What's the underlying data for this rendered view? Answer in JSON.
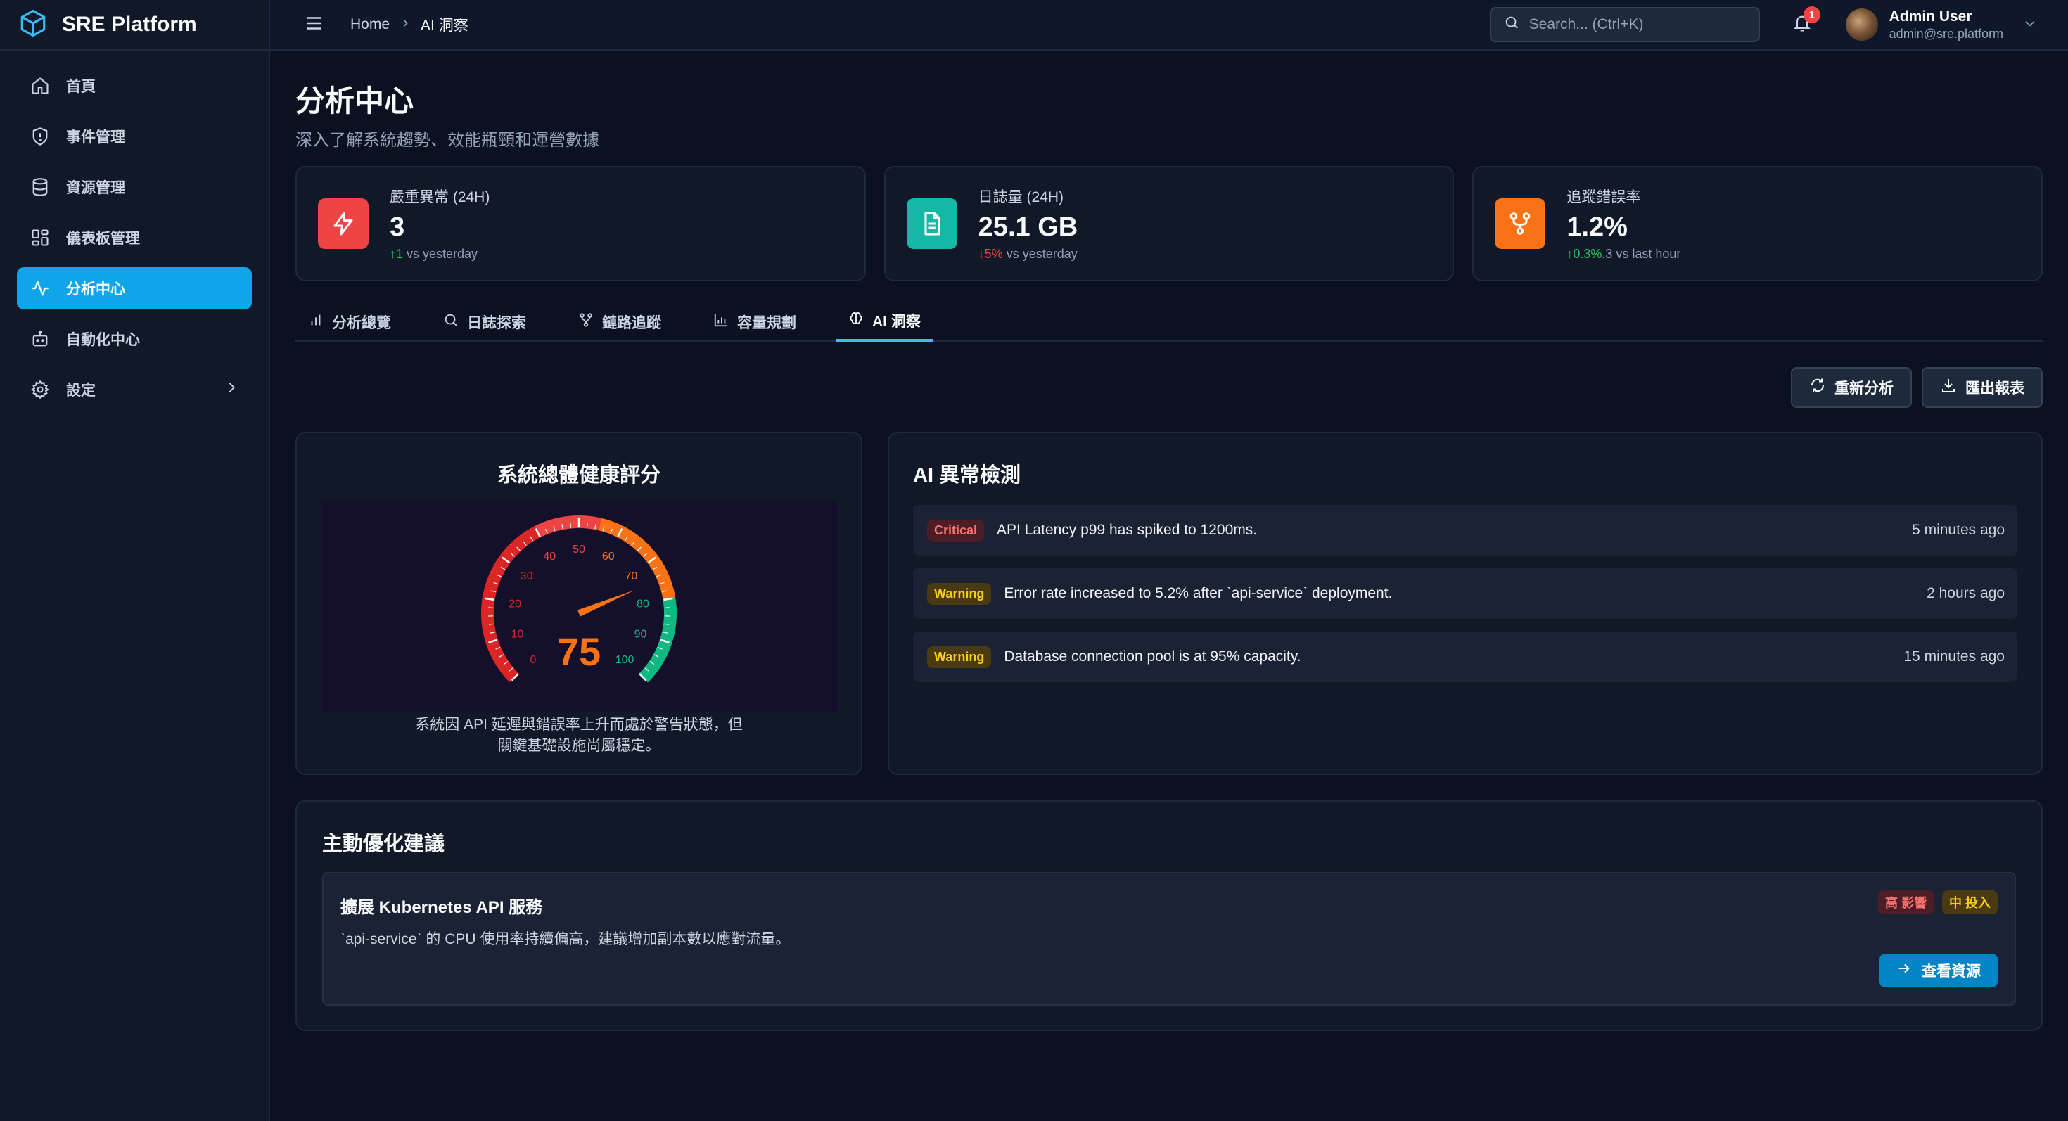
{
  "brand": {
    "name": "SRE Platform"
  },
  "sidebar": {
    "items": [
      {
        "label": "首頁",
        "icon": "home-icon"
      },
      {
        "label": "事件管理",
        "icon": "shield-alert-icon"
      },
      {
        "label": "資源管理",
        "icon": "database-icon"
      },
      {
        "label": "儀表板管理",
        "icon": "dashboard-icon"
      },
      {
        "label": "分析中心",
        "icon": "activity-icon",
        "active": true
      },
      {
        "label": "自動化中心",
        "icon": "bot-icon"
      },
      {
        "label": "設定",
        "icon": "gear-icon"
      }
    ]
  },
  "topbar": {
    "breadcrumb": {
      "home": "Home",
      "current": "AI 洞察"
    },
    "search_placeholder": "Search... (Ctrl+K)",
    "notifications": "1",
    "user": {
      "name": "Admin User",
      "email": "admin@sre.platform"
    }
  },
  "page": {
    "title": "分析中心",
    "subtitle": "深入了解系統趨勢、效能瓶頸和運營數據"
  },
  "stats": [
    {
      "label": "嚴重異常 (24H)",
      "value": "3",
      "delta": "↑1",
      "delta_suffix": " vs yesterday",
      "color": "#ef4444"
    },
    {
      "label": "日誌量 (24H)",
      "value": "25.1 GB",
      "delta": "↓5%",
      "delta_suffix": " vs yesterday",
      "color": "#14b8a6"
    },
    {
      "label": "追蹤錯誤率",
      "value": "1.2%",
      "delta": "↑0.3%",
      "delta_suffix": ".3 vs last hour",
      "color": "#f97316"
    }
  ],
  "tabs": [
    {
      "label": "分析總覽",
      "icon": "bar-chart-icon"
    },
    {
      "label": "日誌探索",
      "icon": "search-icon"
    },
    {
      "label": "鏈路追蹤",
      "icon": "git-fork-icon"
    },
    {
      "label": "容量規劃",
      "icon": "column-chart-icon"
    },
    {
      "label": "AI 洞察",
      "icon": "brain-icon",
      "active": true
    }
  ],
  "actions": {
    "reanalyze": "重新分析",
    "export": "匯出報表"
  },
  "health": {
    "title": "系統總體健康評分",
    "score": 75,
    "gauge_ticks": [
      "0",
      "10",
      "20",
      "30",
      "40",
      "50",
      "60",
      "70",
      "80",
      "90",
      "100"
    ],
    "description": "系統因 API 延遲與錯誤率上升而處於警告狀態，但關鍵基礎設施尚屬穩定。"
  },
  "anomalies": {
    "title": "AI 異常檢測",
    "items": [
      {
        "severity": "Critical",
        "text": "API Latency p99 has spiked to 1200ms.",
        "time": "5 minutes ago"
      },
      {
        "severity": "Warning",
        "text": "Error rate increased to 5.2% after `api-service` deployment.",
        "time": "2 hours ago"
      },
      {
        "severity": "Warning",
        "text": "Database connection pool is at 95% capacity.",
        "time": "15 minutes ago"
      }
    ]
  },
  "optimization": {
    "title": "主動優化建議",
    "item": {
      "title": "擴展 Kubernetes API 服務",
      "description": "`api-service` 的 CPU 使用率持續偏高，建議增加副本數以應對流量。",
      "tag_impact": "高 影響",
      "tag_effort": "中 投入",
      "button": "查看資源"
    }
  }
}
